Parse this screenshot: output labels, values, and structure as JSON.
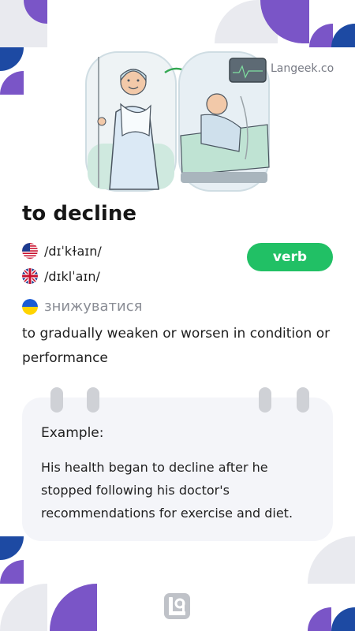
{
  "brand": {
    "name": "Langeek.co"
  },
  "entry": {
    "word": "to decline",
    "part_of_speech": "verb",
    "pronunciations": {
      "us": {
        "ipa": "/dɪˈkɫaɪn/",
        "flag_icon": "us-flag-icon"
      },
      "uk": {
        "ipa": "/dɪklˈaɪn/",
        "flag_icon": "uk-flag-icon"
      }
    },
    "translation": {
      "text": "знижуватися",
      "flag_icon": "ukraine-flag-icon"
    },
    "definition": "to gradually weaken or worsen in condition or performance"
  },
  "example": {
    "label": "Example:",
    "text": "His health began to decline after he stopped following his doctor's recommendations for exercise and diet."
  },
  "colors": {
    "accent_green": "#21c065",
    "purple": "#7a55c7",
    "blue": "#1d4aa3",
    "gray": "#e9eaef"
  }
}
